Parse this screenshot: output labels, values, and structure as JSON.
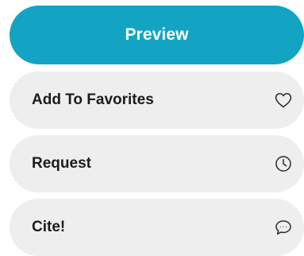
{
  "actions": {
    "preview_label": "Preview",
    "favorites_label": "Add To Favorites",
    "favorites_icon": "heart-icon",
    "request_label": "Request",
    "request_icon": "clock-icon",
    "cite_label": "Cite!",
    "cite_icon": "speech-bubble-icon"
  },
  "colors": {
    "primary": "#13a4c4",
    "secondary_bg": "#eeeeee",
    "text": "#1c1c1c"
  }
}
